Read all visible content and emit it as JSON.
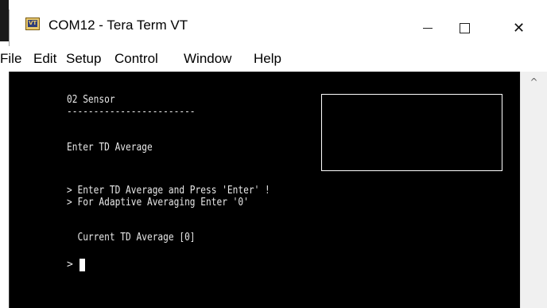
{
  "window": {
    "title": "COM12 - Tera Term VT",
    "icon": "teraterm-vt-icon",
    "controls": {
      "minimize_glyph": "—",
      "close_glyph": "✕"
    }
  },
  "menu": {
    "items": [
      "File",
      "Edit",
      "Setup",
      "Control",
      "Window",
      "Help"
    ]
  },
  "terminal": {
    "lines": [
      "02 Sensor",
      "------------------------",
      "Enter TD Average",
      "> Enter TD Average and Press 'Enter' !",
      "> For Adaptive Averaging Enter '0'",
      "  Current TD Average [0]"
    ],
    "prompt": ">"
  },
  "scrollbar": {
    "up_arrow": "^"
  },
  "colors": {
    "terminal_bg": "#000000",
    "terminal_fg": "#e8e8e8",
    "chrome_bg": "#ffffff"
  }
}
